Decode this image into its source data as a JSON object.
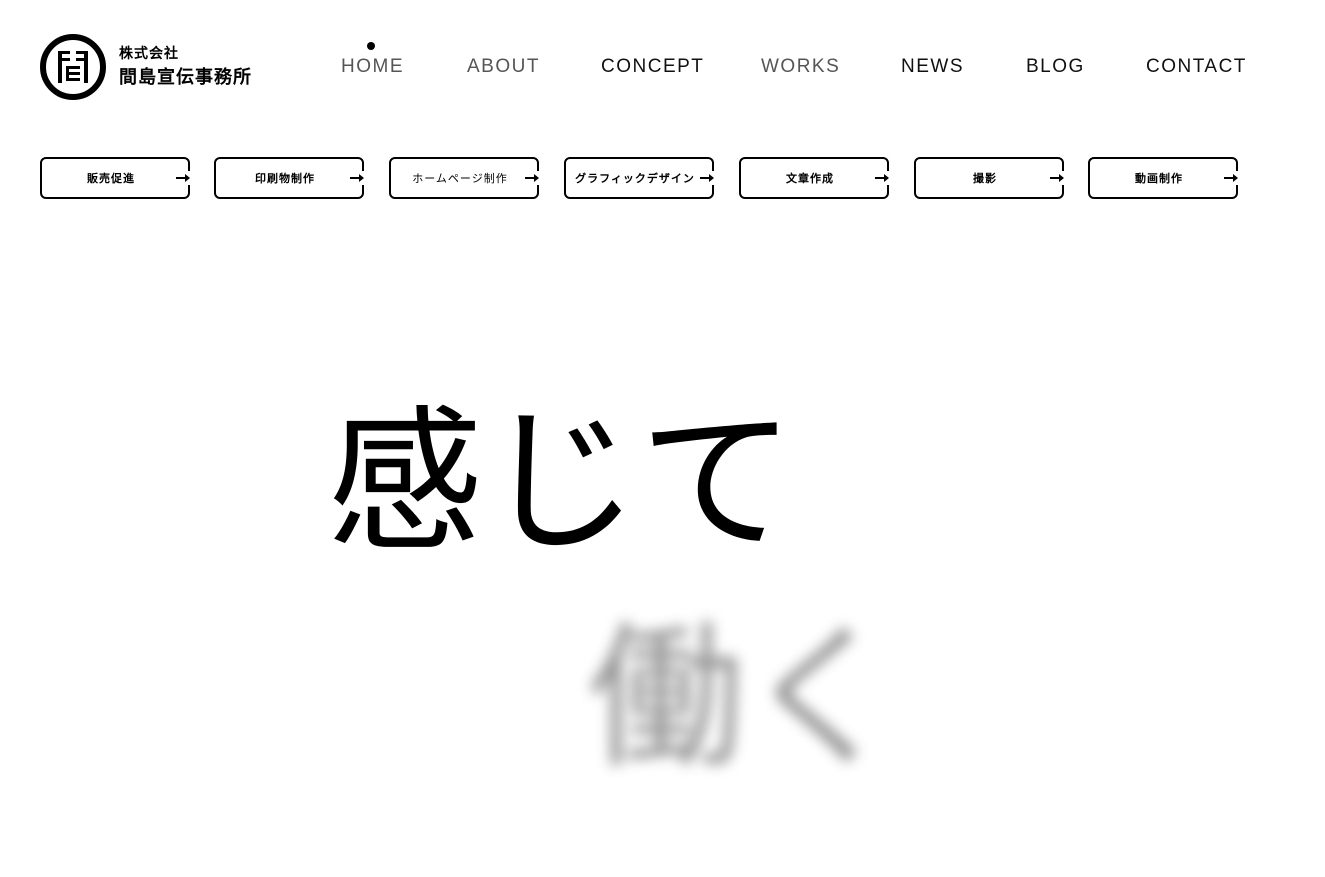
{
  "logo": {
    "company_type": "株式会社",
    "company_name": "間島宣伝事務所",
    "mark_icon": "maji-kanji-emblem-icon"
  },
  "nav": {
    "items": [
      {
        "label": "HOME",
        "color": "#555555"
      },
      {
        "label": "ABOUT",
        "color": "#555555"
      },
      {
        "label": "CONCEPT",
        "color": "#111111"
      },
      {
        "label": "WORKS",
        "color": "#555555"
      },
      {
        "label": "NEWS",
        "color": "#111111"
      },
      {
        "label": "BLOG",
        "color": "#111111"
      },
      {
        "label": "CONTACT",
        "color": "#111111"
      }
    ],
    "active_item": "HOME",
    "active_icon": "dot-indicator-icon"
  },
  "categories": {
    "items": [
      {
        "label": "販売促進"
      },
      {
        "label": "印刷物制作"
      },
      {
        "label": "ホームページ制作"
      },
      {
        "label": "グラフィックデザイン"
      },
      {
        "label": "文章作成"
      },
      {
        "label": "撮影"
      },
      {
        "label": "動画制作"
      }
    ],
    "arrow_icon": "arrow-right-icon"
  },
  "hero": {
    "line1": "感じて",
    "line2": "働く"
  },
  "colors": {
    "background": "#ffffff",
    "text": "#000000",
    "blurred_text": "#8a8a8a"
  }
}
